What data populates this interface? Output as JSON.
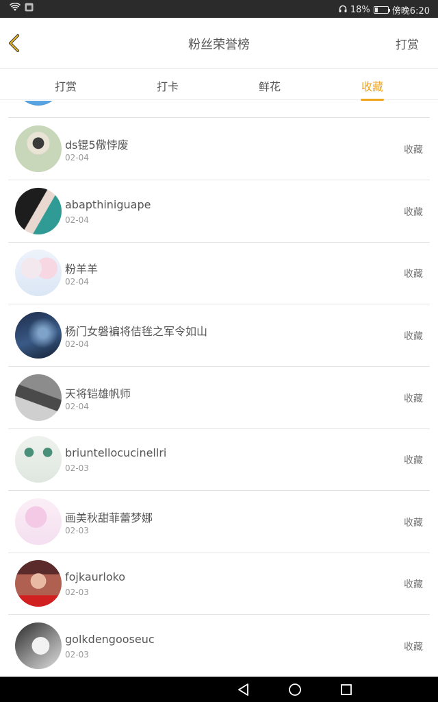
{
  "status_bar": {
    "battery_level": 0.18,
    "battery_text": "18%",
    "time": "傍晚6:20"
  },
  "header": {
    "title": "粉丝荣誉榜",
    "right_action": "打赏"
  },
  "tabs": [
    {
      "label": "打赏",
      "active": false
    },
    {
      "label": "打卡",
      "active": false
    },
    {
      "label": "鲜花",
      "active": false
    },
    {
      "label": "收藏",
      "active": true
    }
  ],
  "accent_color": "#f0a318",
  "fans": [
    {
      "name": "ds锟5儆悖废",
      "date": "02-04",
      "action": "收藏"
    },
    {
      "name": "abapthiniguape",
      "date": "02-04",
      "action": "收藏"
    },
    {
      "name": "粉羊羊",
      "date": "02-04",
      "action": "收藏"
    },
    {
      "name": "杨门女磐褊将佶毪之军令如山",
      "date": "02-04",
      "action": "收藏"
    },
    {
      "name": "天将铠雄帆师",
      "date": "02-04",
      "action": "收藏"
    },
    {
      "name": "briuntellocucinellri",
      "date": "02-03",
      "action": "收藏"
    },
    {
      "name": "画美秋甜菲蕾梦娜",
      "date": "02-03",
      "action": "收藏"
    },
    {
      "name": "fojkaurloko",
      "date": "02-03",
      "action": "收藏"
    },
    {
      "name": "golkdengooseuc",
      "date": "02-03",
      "action": "收藏"
    }
  ],
  "nav": {
    "back_icon": "triangle-back-icon",
    "home_icon": "circle-home-icon",
    "recents_icon": "square-recents-icon"
  }
}
